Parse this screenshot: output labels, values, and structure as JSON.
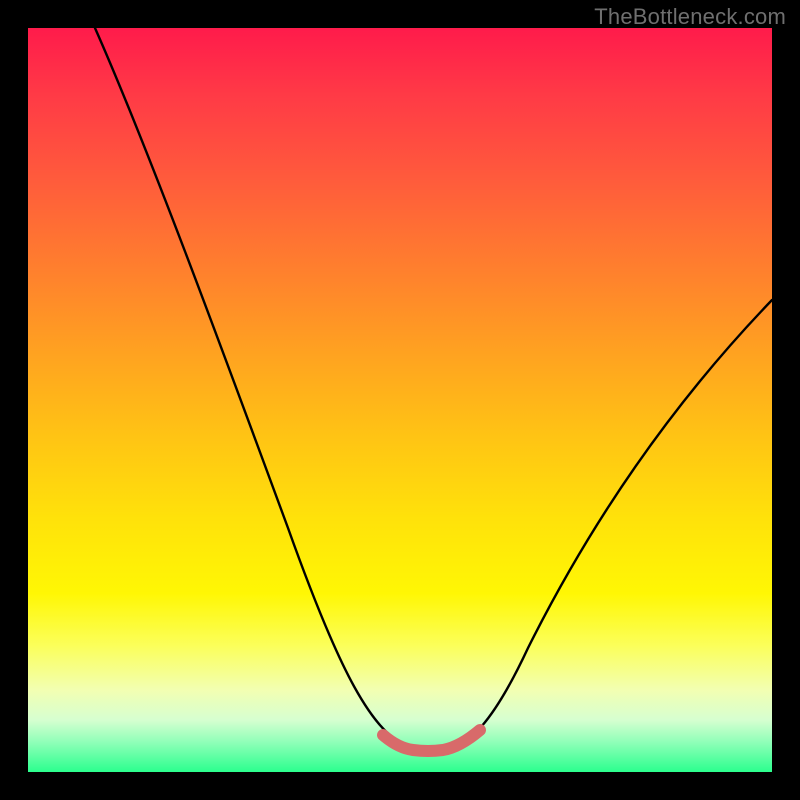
{
  "watermark": "TheBottleneck.com",
  "colors": {
    "page_bg": "#000000",
    "curve": "#000000",
    "flat_highlight": "#d86a6a",
    "gradient_top": "#ff1b4b",
    "gradient_bottom": "#2bff8e"
  },
  "chart_data": {
    "type": "line",
    "title": "",
    "xlabel": "",
    "ylabel": "",
    "xlim": [
      0,
      100
    ],
    "ylim": [
      0,
      100
    ],
    "note": "No axes or tick labels are visible in the image; axis ranges are normalized to 0-100. y is visually inverted (higher curve position = higher y value here).",
    "series": [
      {
        "name": "curve",
        "color": "#000000",
        "x": [
          9,
          12,
          15,
          18,
          21,
          24,
          27,
          30,
          33,
          36,
          39,
          42,
          45,
          48,
          50,
          52,
          54,
          56,
          58,
          60,
          62,
          65,
          68,
          72,
          76,
          80,
          84,
          88,
          92,
          96,
          100
        ],
        "values": [
          100,
          94,
          88,
          82,
          76,
          70,
          63,
          56,
          49,
          42,
          35,
          28,
          21,
          14,
          9,
          5,
          3,
          2,
          2,
          3,
          5,
          9,
          14,
          21,
          28,
          35,
          41,
          47,
          53,
          58,
          63
        ]
      },
      {
        "name": "flat-bottom-highlight",
        "color": "#d86a6a",
        "x": [
          50,
          52,
          54,
          56,
          58,
          60,
          62
        ],
        "values": [
          4.5,
          3.2,
          2.5,
          2.2,
          2.5,
          3.2,
          4.5
        ]
      }
    ]
  }
}
